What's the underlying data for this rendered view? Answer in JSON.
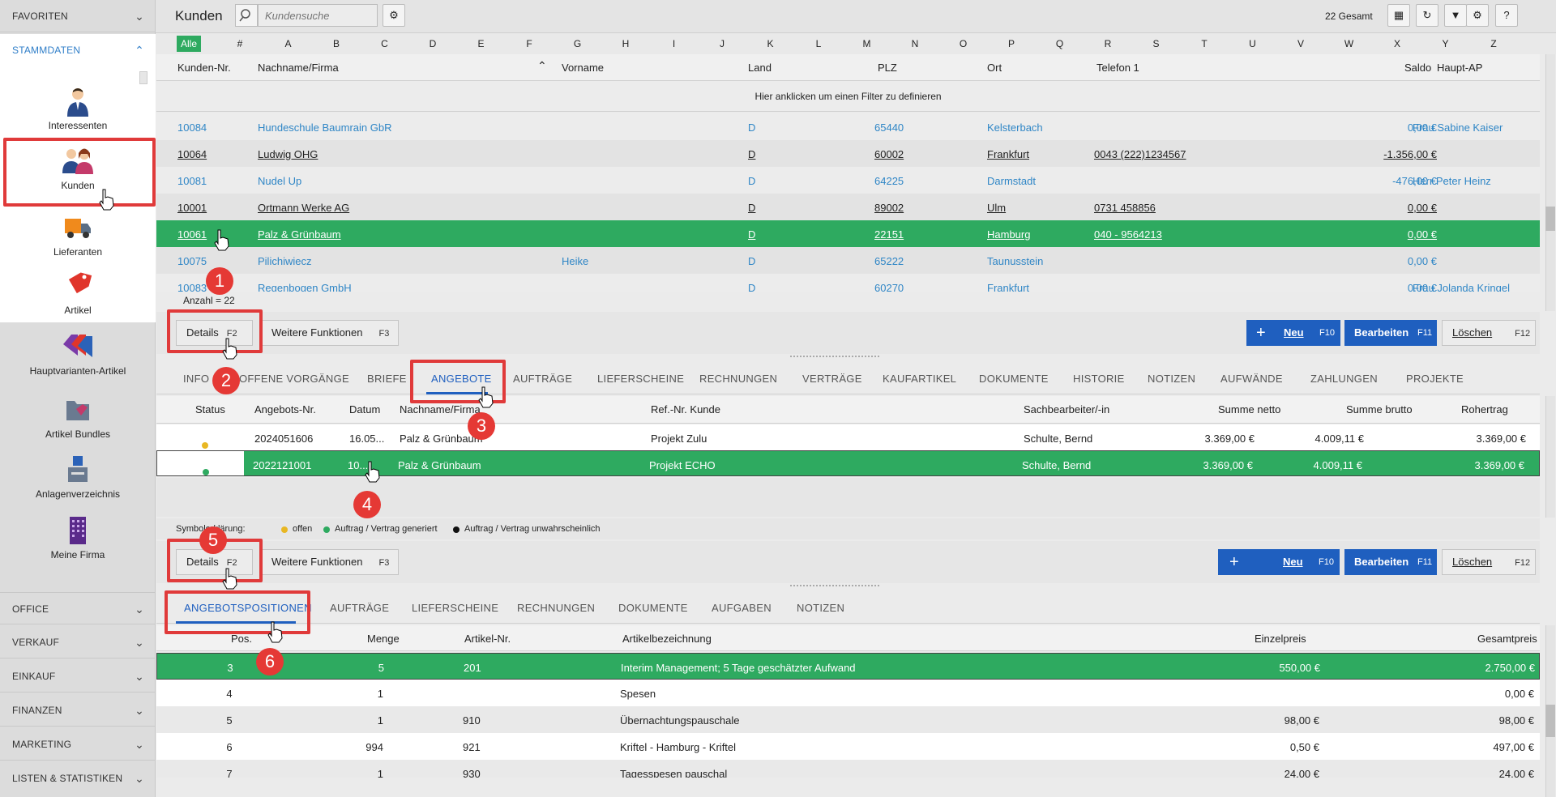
{
  "sidebar": {
    "favoriten": "FAVORITEN",
    "stammdaten": "STAMMDATEN",
    "items": [
      {
        "label": "Interessenten",
        "icon": "person-icon"
      },
      {
        "label": "Kunden",
        "icon": "customers-icon"
      },
      {
        "label": "Lieferanten",
        "icon": "truck-icon"
      },
      {
        "label": "Artikel",
        "icon": "tag-icon"
      },
      {
        "label": "Hauptvarianten-Artikel",
        "icon": "tags-icon"
      },
      {
        "label": "Artikel Bundles",
        "icon": "bundle-icon"
      },
      {
        "label": "Anlagenverzeichnis",
        "icon": "asset-icon"
      },
      {
        "label": "Meine Firma",
        "icon": "building-icon"
      }
    ],
    "sections": [
      "OFFICE",
      "VERKAUF",
      "EINKAUF",
      "FINANZEN",
      "MARKETING",
      "LISTEN & STATISTIKEN"
    ]
  },
  "topbar": {
    "title": "Kunden",
    "search_placeholder": "Kundensuche",
    "total": "22 Gesamt"
  },
  "letters": {
    "all": "Alle",
    "list": [
      "#",
      "A",
      "B",
      "C",
      "D",
      "E",
      "F",
      "G",
      "H",
      "I",
      "J",
      "K",
      "L",
      "M",
      "N",
      "O",
      "P",
      "Q",
      "R",
      "S",
      "T",
      "U",
      "V",
      "W",
      "X",
      "Y",
      "Z"
    ]
  },
  "customers": {
    "columns": [
      "Kunden-Nr.",
      "Nachname/Firma",
      "Vorname",
      "Land",
      "PLZ",
      "Ort",
      "Telefon 1",
      "Saldo",
      "Haupt-AP"
    ],
    "filter_hint": "Hier anklicken um einen Filter zu definieren",
    "rows": [
      {
        "nr": "10084",
        "name": "Hundeschule Baumrain GbR",
        "vorname": "",
        "land": "D",
        "plz": "65440",
        "ort": "Kelsterbach",
        "tel": "",
        "saldo": "0,00 €",
        "ap": "Frau Sabine Kaiser"
      },
      {
        "nr": "10064",
        "name": "Ludwig OHG",
        "vorname": "",
        "land": "D",
        "plz": "60002",
        "ort": "Frankfurt",
        "tel": "0043 (222)1234567",
        "saldo": "-1.356,00 €",
        "ap": ""
      },
      {
        "nr": "10081",
        "name": "Nudel Up",
        "vorname": "",
        "land": "D",
        "plz": "64225",
        "ort": "Darmstadt",
        "tel": "",
        "saldo": "-476,00 €",
        "ap": "Herr Peter Heinz"
      },
      {
        "nr": "10001",
        "name": "Ortmann Werke AG",
        "vorname": "",
        "land": "D",
        "plz": "89002",
        "ort": "Ulm",
        "tel": "0731 458856",
        "saldo": "0,00 €",
        "ap": ""
      },
      {
        "nr": "10061",
        "name": "Palz & Grünbaum",
        "vorname": "",
        "land": "D",
        "plz": "22151",
        "ort": "Hamburg",
        "tel": "040 - 9564213",
        "saldo": "0,00 €",
        "ap": ""
      },
      {
        "nr": "10075",
        "name": "Pilichiwiecz",
        "vorname": "Heike",
        "land": "D",
        "plz": "65222",
        "ort": "Taunusstein",
        "tel": "",
        "saldo": "0,00 €",
        "ap": ""
      },
      {
        "nr": "10083",
        "name": "Regenbogen GmbH",
        "vorname": "",
        "land": "D",
        "plz": "60270",
        "ort": "Frankfurt",
        "tel": "",
        "saldo": "0,00 €",
        "ap": "Frau Jolanda Kringel"
      }
    ],
    "count": "Anzahl = 22"
  },
  "actions1": {
    "details": "Details",
    "details_key": "F2",
    "weitere": "Weitere Funktionen",
    "weitere_key": "F3",
    "neu": "Neu",
    "neu_key": "F10",
    "bearbeiten": "Bearbeiten",
    "bearbeiten_key": "F11",
    "loeschen": "Löschen",
    "loeschen_key": "F12"
  },
  "tabs1": [
    "INFO",
    "OFFENE VORGÄNGE",
    "BRIEFE",
    "ANGEBOTE",
    "AUFTRÄGE",
    "LIEFERSCHEINE",
    "RECHNUNGEN",
    "VERTRÄGE",
    "KAUFARTIKEL",
    "DOKUMENTE",
    "HISTORIE",
    "NOTIZEN",
    "AUFWÄNDE",
    "ZAHLUNGEN",
    "PROJEKTE"
  ],
  "offers": {
    "columns": [
      "Status",
      "Angebots-Nr.",
      "Datum",
      "Nachname/Firma",
      "Ref.-Nr. Kunde",
      "Sachbearbeiter/-in",
      "Summe netto",
      "Summe brutto",
      "Rohertrag"
    ],
    "rows": [
      {
        "status_color": "#e8b723",
        "nr": "2024051606",
        "datum": "16.05...",
        "name": "Palz & Grünbaum",
        "ref": "Projekt Zulu",
        "sb": "Schulte, Bernd",
        "netto": "3.369,00 €",
        "brutto": "4.009,11 €",
        "roh": "3.369,00 €"
      },
      {
        "status_color": "#2eaa60",
        "nr": "2022121001",
        "datum": "10...",
        "name": "Palz & Grünbaum",
        "ref": "Projekt ECHO",
        "sb": "Schulte, Bernd",
        "netto": "3.369,00 €",
        "brutto": "4.009,11 €",
        "roh": "3.369,00 €"
      }
    ]
  },
  "legend": {
    "label": "Symbolerklärung:",
    "items": [
      {
        "color": "#e8b723",
        "text": "offen"
      },
      {
        "color": "#2eaa60",
        "text": "Auftrag / Vertrag generiert"
      },
      {
        "color": "#111111",
        "text": "Auftrag / Vertrag unwahrscheinlich"
      }
    ]
  },
  "tabs2": [
    "ANGEBOTSPOSITIONEN",
    "AUFTRÄGE",
    "LIEFERSCHEINE",
    "RECHNUNGEN",
    "DOKUMENTE",
    "AUFGABEN",
    "NOTIZEN"
  ],
  "positions": {
    "columns": [
      "Pos.",
      "Menge",
      "Artikel-Nr.",
      "Artikelbezeichnung",
      "Einzelpreis",
      "Gesamtpreis"
    ],
    "rows": [
      {
        "pos": "3",
        "menge": "5",
        "art": "201",
        "bez": "Interim Management; 5 Tage geschätzter Aufwand",
        "ep": "550,00 €",
        "gp": "2.750,00 €"
      },
      {
        "pos": "4",
        "menge": "1",
        "art": "",
        "bez": "Spesen",
        "ep": "",
        "gp": "0,00 €"
      },
      {
        "pos": "5",
        "menge": "1",
        "art": "910",
        "bez": "Übernachtungspauschale",
        "ep": "98,00 €",
        "gp": "98,00 €"
      },
      {
        "pos": "6",
        "menge": "994",
        "art": "921",
        "bez": "Kriftel - Hamburg - Kriftel",
        "ep": "0,50 €",
        "gp": "497,00 €"
      },
      {
        "pos": "7",
        "menge": "1",
        "art": "930",
        "bez": "Tagesspesen pauschal",
        "ep": "24,00 €",
        "gp": "24,00 €"
      }
    ]
  },
  "badges": [
    "1",
    "2",
    "3",
    "4",
    "5",
    "6"
  ],
  "colors": {
    "selected": "#2eaa60",
    "primary": "#1f5fbf",
    "highlight": "#e03a3a",
    "link": "#2f86c6"
  }
}
